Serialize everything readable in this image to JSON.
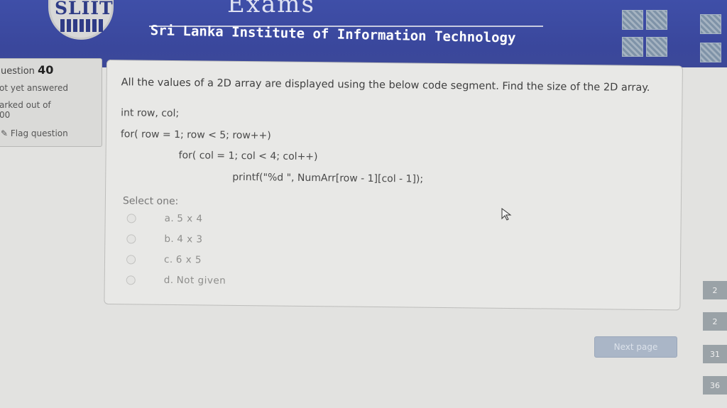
{
  "header": {
    "logo_text": "SLIIT",
    "exams_title": "Exams",
    "institute": "Sri Lanka Institute of Information Technology"
  },
  "info": {
    "question_prefix": "uestion",
    "question_number": "40",
    "status": "ot yet answered",
    "marked_out_of": "arked out of",
    "marks": "00",
    "flag": "Flag question"
  },
  "question": {
    "text": "All the values of a 2D array are displayed using the below code segment. Find the size of the 2D array.",
    "code": [
      "int row, col;",
      "for( row = 1; row < 5; row++)",
      "for( col = 1; col < 4; col++)",
      "printf(\"%d \", NumArr[row - 1][col - 1]);"
    ],
    "select_one": "Select one:",
    "options": [
      {
        "letter": "a.",
        "text": "5 x 4"
      },
      {
        "letter": "b.",
        "text": "4 x 3"
      },
      {
        "letter": "c.",
        "text": "6 x 5"
      },
      {
        "letter": "d.",
        "text": "Not given"
      }
    ]
  },
  "nav": {
    "next_page": "Next page",
    "page_numbers": [
      "2",
      "2",
      "31",
      "36"
    ]
  },
  "colors": {
    "header_blue": "#3f4fa8",
    "panel_bg": "#e8e8e6",
    "button_bg": "#aab6c7"
  }
}
